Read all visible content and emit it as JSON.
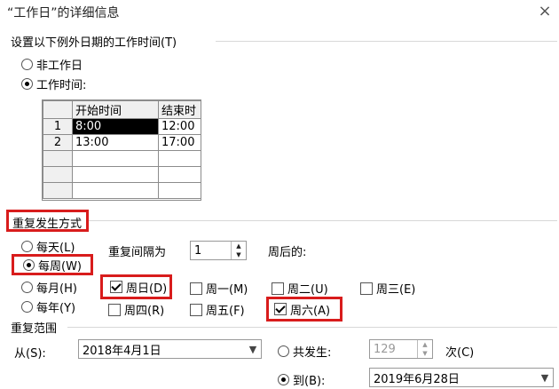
{
  "window": {
    "title": "“工作日”的详细信息",
    "close_label": "×"
  },
  "worktime": {
    "section_label": "设置以下例外日期的工作时间(T)",
    "nonwork_label": "非工作日",
    "work_label": "工作时间:",
    "table": {
      "headers": [
        "开始时间",
        "结束时"
      ],
      "rows": [
        {
          "num": "1",
          "start": "8:00",
          "end": "12:00"
        },
        {
          "num": "2",
          "start": "13:00",
          "end": "17:00"
        }
      ]
    }
  },
  "recurrence": {
    "section_label": "重复发生方式",
    "daily": "每天(L)",
    "weekly": "每周(W)",
    "monthly": "每月(H)",
    "yearly": "每年(Y)",
    "interval_label": "重复间隔为",
    "interval_value": "1",
    "weeks_after_label": "周后的:",
    "days": {
      "sun": "周日(D)",
      "mon": "周一(M)",
      "tue": "周二(U)",
      "wed": "周三(E)",
      "thu": "周四(R)",
      "fri": "周五(F)",
      "sat": "周六(A)"
    }
  },
  "range": {
    "section_label": "重复范围",
    "from_label": "从(S):",
    "from_value": "2018年4月1日",
    "occur_label": "共发生:",
    "occur_value": "129",
    "times_label": "次(C)",
    "to_label": "到(B):",
    "to_value": "2019年6月28日"
  },
  "colors": {
    "highlight": "#d81c1c"
  }
}
